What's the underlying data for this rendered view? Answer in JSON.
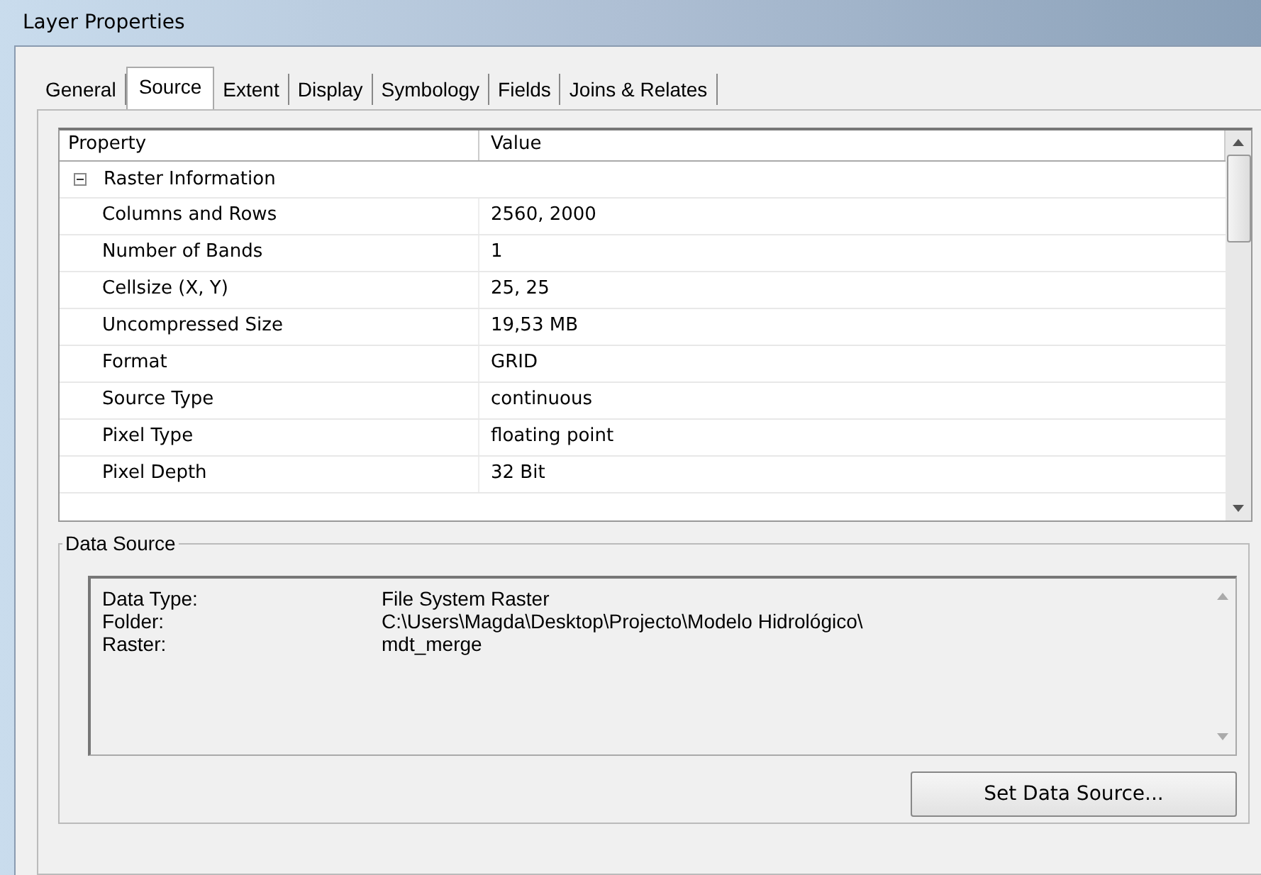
{
  "window": {
    "title": "Layer Properties"
  },
  "tabs": [
    {
      "label": "General",
      "selected": false
    },
    {
      "label": "Source",
      "selected": true
    },
    {
      "label": "Extent",
      "selected": false
    },
    {
      "label": "Display",
      "selected": false
    },
    {
      "label": "Symbology",
      "selected": false
    },
    {
      "label": "Fields",
      "selected": false
    },
    {
      "label": "Joins & Relates",
      "selected": false
    }
  ],
  "table": {
    "columns": [
      "Property",
      "Value"
    ],
    "groups": [
      {
        "label": "Raster Information",
        "expanded": true,
        "rows": [
          {
            "property": "Columns and Rows",
            "value": "2560, 2000"
          },
          {
            "property": "Number of Bands",
            "value": "1"
          },
          {
            "property": "Cellsize (X, Y)",
            "value": "25, 25"
          },
          {
            "property": "Uncompressed Size",
            "value": "19,53 MB"
          },
          {
            "property": "Format",
            "value": "GRID"
          },
          {
            "property": "Source Type",
            "value": "continuous"
          },
          {
            "property": "Pixel Type",
            "value": "floating point"
          },
          {
            "property": "Pixel Depth",
            "value": "32 Bit"
          }
        ]
      }
    ]
  },
  "data_source": {
    "title": "Data Source",
    "lines": [
      {
        "label": "Data Type:",
        "value": "File System Raster"
      },
      {
        "label": "Folder:",
        "value": "C:\\Users\\Magda\\Desktop\\Projecto\\Modelo Hidrológico\\"
      },
      {
        "label": "Raster:",
        "value": "mdt_merge"
      }
    ],
    "button": "Set Data Source..."
  }
}
